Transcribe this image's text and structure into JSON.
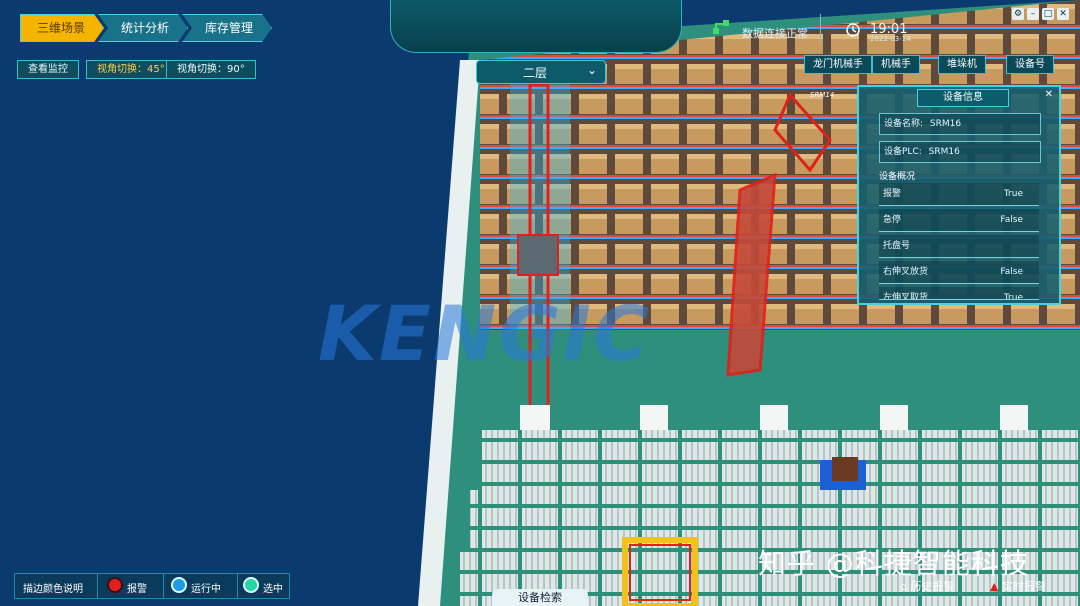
{
  "nav": {
    "tabs": [
      {
        "label": "三维场景"
      },
      {
        "label": "统计分析"
      },
      {
        "label": "库存管理"
      }
    ]
  },
  "toolbar": {
    "view_monitor": "查看监控",
    "view_45": "视角切换：45°",
    "view_90": "视角切换：90°"
  },
  "floor": {
    "selected": "二层"
  },
  "status": {
    "connection_text": "数据连接正常",
    "time": "19:01",
    "date": "2022-03-14"
  },
  "equipment_tabs": [
    "龙门机械手",
    "机械手",
    "堆垛机",
    "设备号"
  ],
  "device_panel": {
    "title": "设备信息",
    "name_label": "设备名称:",
    "name_value": "SRM16",
    "plc_label": "设备PLC:",
    "plc_value": "SRM16",
    "overview_label": "设备概况",
    "rows": [
      {
        "key": "报警",
        "value": "True"
      },
      {
        "key": "急停",
        "value": "False"
      },
      {
        "key": "托盘号",
        "value": ""
      },
      {
        "key": "右伸叉放货",
        "value": "False"
      },
      {
        "key": "左伸叉取货",
        "value": "True"
      }
    ]
  },
  "scene": {
    "logo": "KENGIC",
    "srm_label": "SRM14"
  },
  "legend": {
    "title": "描边颜色说明",
    "alarm": "报警",
    "running": "运行中",
    "selected": "选中",
    "alarm_color": "#e0201b",
    "running_color": "#1e9be6",
    "selected_color": "#26d6a6"
  },
  "bottom": {
    "device_search": "设备检索",
    "history_alarm": "历史报警",
    "realtime_alarm": "实时报警"
  },
  "watermark": "知乎 @科捷智能科技"
}
